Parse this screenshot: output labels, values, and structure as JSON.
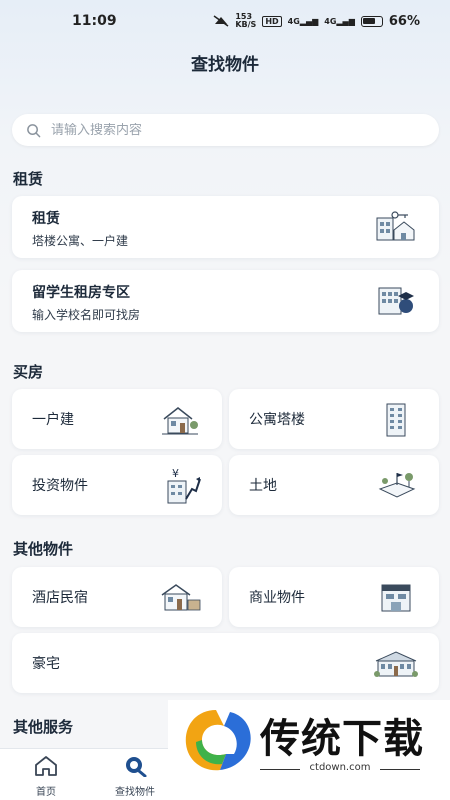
{
  "status_bar": {
    "time": "11:09",
    "net_speed_top": "153",
    "net_speed_bottom": "KB/S",
    "hd": "HD",
    "signal1": "4G",
    "signal2": "4G",
    "battery": "66%"
  },
  "header": {
    "title": "查找物件"
  },
  "search": {
    "placeholder": "请输入搜索内容"
  },
  "sections": {
    "rent": {
      "title": "租赁",
      "cards": [
        {
          "title": "租赁",
          "subtitle": "塔楼公寓、一户建",
          "icon": "house-key-icon"
        },
        {
          "title": "留学生租房专区",
          "subtitle": "输入学校名即可找房",
          "icon": "student-building-icon"
        }
      ]
    },
    "buy": {
      "title": "买房",
      "items": [
        {
          "label": "一户建",
          "icon": "detached-house-icon"
        },
        {
          "label": "公寓塔楼",
          "icon": "apartment-tower-icon"
        },
        {
          "label": "投资物件",
          "icon": "investment-building-icon"
        },
        {
          "label": "土地",
          "icon": "land-plot-icon"
        }
      ]
    },
    "other": {
      "title": "其他物件",
      "items": [
        {
          "label": "酒店民宿",
          "icon": "hotel-icon"
        },
        {
          "label": "商业物件",
          "icon": "commercial-building-icon"
        },
        {
          "label": "豪宅",
          "icon": "mansion-icon"
        }
      ]
    },
    "services": {
      "title": "其他服务"
    }
  },
  "tabs": [
    {
      "label": "首页",
      "icon": "home-icon",
      "active": false
    },
    {
      "label": "查找物件",
      "icon": "search-tab-icon",
      "active": true
    }
  ],
  "watermark": {
    "text": "传统下载",
    "url": "ctdown.com"
  }
}
